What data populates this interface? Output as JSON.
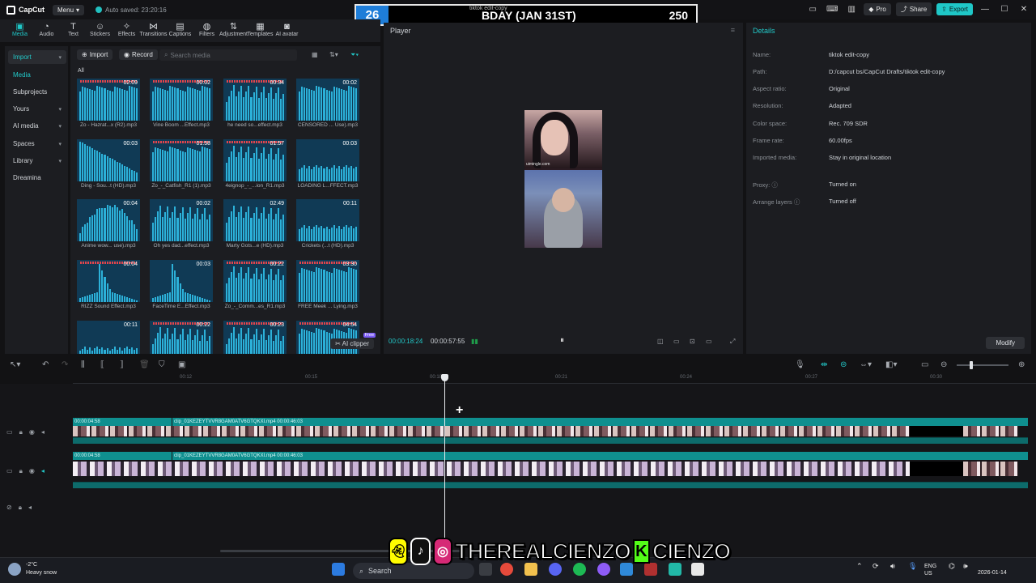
{
  "app": {
    "name": "CapCut",
    "menu_label": "Menu",
    "autosave": "Auto saved: 23:20:16",
    "pro_label": "Pro",
    "share_label": "Share",
    "export_label": "Export",
    "project_title": "tiktok edit-copy"
  },
  "counter": {
    "count": "26",
    "label": "BDAY (JAN 31ST)",
    "goal": "250"
  },
  "tools": [
    {
      "label": "Media",
      "icon": "media-icon",
      "glyph": "▣"
    },
    {
      "label": "Audio",
      "icon": "audio-icon",
      "glyph": "◔"
    },
    {
      "label": "Text",
      "icon": "text-icon",
      "glyph": "T"
    },
    {
      "label": "Stickers",
      "icon": "sticker-icon",
      "glyph": "☺"
    },
    {
      "label": "Effects",
      "icon": "effects-icon",
      "glyph": "✧"
    },
    {
      "label": "Transitions",
      "icon": "transitions-icon",
      "glyph": "⋈"
    },
    {
      "label": "Captions",
      "icon": "captions-icon",
      "glyph": "▤"
    },
    {
      "label": "Filters",
      "icon": "filters-icon",
      "glyph": "◍"
    },
    {
      "label": "Adjustment",
      "icon": "adjustment-icon",
      "glyph": "⇅"
    },
    {
      "label": "Templates",
      "icon": "templates-icon",
      "glyph": "▦"
    },
    {
      "label": "AI avatar",
      "icon": "ai-avatar-icon",
      "glyph": "◙"
    }
  ],
  "leftnav": [
    {
      "label": "Import",
      "chev": "▾",
      "sel": true
    },
    {
      "label": "Media",
      "chev": "",
      "sel": false,
      "accent": true
    },
    {
      "label": "Subprojects",
      "chev": "",
      "sel": false
    },
    {
      "label": "Yours",
      "chev": "▾",
      "sel": false
    },
    {
      "label": "AI media",
      "chev": "▾",
      "sel": false
    },
    {
      "label": "Spaces",
      "chev": "▾",
      "sel": false
    },
    {
      "label": "Library",
      "chev": "▾",
      "sel": false
    },
    {
      "label": "Dreamina",
      "chev": "",
      "sel": false
    }
  ],
  "media": {
    "import_label": "Import",
    "record_label": "Record",
    "search_placeholder": "Search media",
    "section_label": "All",
    "ai_clipper": "AI clipper",
    "free_badge": "Free",
    "tiles": [
      {
        "name": "Zo - Hazrat...x (R2).mp3",
        "dur": "02:09",
        "red": true,
        "shape": "flat"
      },
      {
        "name": "Vine Boom ...Effect.mp3",
        "dur": "00:02",
        "red": true,
        "shape": "flat"
      },
      {
        "name": "he need so...effect.mp3",
        "dur": "00:34",
        "red": true,
        "shape": "rough"
      },
      {
        "name": "CENSORED ... Use).mp3",
        "dur": "00:02",
        "red": false,
        "shape": "flat"
      },
      {
        "name": "Ding - Sou...t (HD).mp3",
        "dur": "00:03",
        "red": false,
        "shape": "decay"
      },
      {
        "name": "Zo_-_Catfish_R1 (1).mp3",
        "dur": "01:58",
        "red": true,
        "shape": "flat"
      },
      {
        "name": "4eignop_-_...ion_R1.mp3",
        "dur": "01:57",
        "red": true,
        "shape": "rough"
      },
      {
        "name": "LOADING L...FFECT.mp3",
        "dur": "00:03",
        "red": false,
        "shape": "low"
      },
      {
        "name": "Anime wow... use).mp3",
        "dur": "00:04",
        "red": false,
        "shape": "hump"
      },
      {
        "name": "Oh yes dad...effect.mp3",
        "dur": "00:02",
        "red": false,
        "shape": "rough"
      },
      {
        "name": "Marty Gots...e (HD).mp3",
        "dur": "02:49",
        "red": false,
        "shape": "rough"
      },
      {
        "name": "Crickets (...t (HD).mp3",
        "dur": "00:11",
        "red": false,
        "shape": "low"
      },
      {
        "name": "RIZZ Sound Effect.mp3",
        "dur": "00:04",
        "red": true,
        "shape": "spike"
      },
      {
        "name": "FaceTime E...Effect.mp3",
        "dur": "00:03",
        "red": false,
        "shape": "spike"
      },
      {
        "name": "Zo_-_Comm...es_R1.mp3",
        "dur": "00:22",
        "red": true,
        "shape": "rough"
      },
      {
        "name": "FREE Meek ... Lying.mp3",
        "dur": "03:30",
        "red": true,
        "shape": "flat"
      },
      {
        "name": "",
        "dur": "00:11",
        "red": false,
        "shape": "low"
      },
      {
        "name": "",
        "dur": "00:22",
        "red": true,
        "shape": "rough"
      },
      {
        "name": "",
        "dur": "00:23",
        "red": true,
        "shape": "rough"
      },
      {
        "name": "",
        "dur": "04:54",
        "red": true,
        "shape": "flat"
      }
    ]
  },
  "player": {
    "title": "Player",
    "current": "00:00:18:24",
    "total": "00:00:57:55",
    "watermark": "uimingle.com"
  },
  "details": {
    "title": "Details",
    "rows": [
      {
        "k": "Name:",
        "v": "tiktok edit-copy"
      },
      {
        "k": "Path:",
        "v": "D:/capcut bs/CapCut Drafts/tiktok edit-copy"
      },
      {
        "k": "Aspect ratio:",
        "v": "Original"
      },
      {
        "k": "Resolution:",
        "v": "Adapted"
      },
      {
        "k": "Color space:",
        "v": "Rec. 709 SDR"
      },
      {
        "k": "Frame rate:",
        "v": "60.00fps"
      },
      {
        "k": "Imported media:",
        "v": "Stay in original location"
      },
      {
        "k": "Proxy: ⓘ",
        "v": "Turned on"
      },
      {
        "k": "Arrange layers ⓘ",
        "v": "Turned off"
      }
    ],
    "modify_label": "Modify"
  },
  "timeline": {
    "ticks": [
      "00:12",
      "00:15",
      "00:18",
      "00:21",
      "00:24",
      "00:27",
      "00:30"
    ],
    "clip_a_label": "00:00:04:58",
    "clip_b_label": "clip_01KEZEYTVVR8GAM0ATV6GTQKXI.mp4  00:00:46:03"
  },
  "taskbar": {
    "temp": "-2°C",
    "weather": "Heavy snow",
    "search": "Search",
    "lang1": "ENG",
    "lang2": "US",
    "date": "2026-01-14"
  },
  "banner": {
    "handle1": "THEREALCIENZO",
    "handle2": "CIENZO",
    "kick": "K"
  }
}
